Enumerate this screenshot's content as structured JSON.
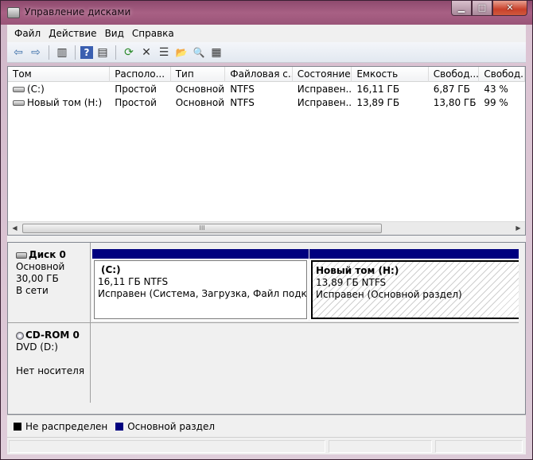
{
  "window": {
    "title": "Управление дисками",
    "minimize_glyph": "▁",
    "maximize_glyph": "□",
    "close_glyph": "✕"
  },
  "menu": {
    "items": [
      {
        "label": "Файл"
      },
      {
        "label": "Действие"
      },
      {
        "label": "Вид"
      },
      {
        "label": "Справка"
      }
    ]
  },
  "toolbar": {
    "buttons": [
      {
        "icon": "back-arrow-icon",
        "glyph": "⇦"
      },
      {
        "icon": "forward-arrow-icon",
        "glyph": "⇨"
      },
      {
        "icon": "show-hide-console-tree-icon",
        "glyph": "▥"
      },
      {
        "icon": "help-icon",
        "glyph": "?"
      },
      {
        "icon": "properties-pane-icon",
        "glyph": "▤"
      },
      {
        "icon": "refresh-icon",
        "glyph": "⟳"
      },
      {
        "icon": "delete-icon",
        "glyph": "✕"
      },
      {
        "icon": "properties-icon",
        "glyph": "☰"
      },
      {
        "icon": "open-folder-icon",
        "glyph": "📂"
      },
      {
        "icon": "search-icon",
        "glyph": "🔍"
      },
      {
        "icon": "disk-properties-icon",
        "glyph": "▦"
      }
    ]
  },
  "volume_list": {
    "columns": [
      "Том",
      "Располо...",
      "Тип",
      "Файловая с...",
      "Состояние",
      "Емкость",
      "Свобод...",
      "Свобод..."
    ],
    "rows": [
      {
        "volume": "(C:)",
        "layout": "Простой",
        "type": "Основной",
        "fs": "NTFS",
        "status": "Исправен...",
        "capacity": "16,11 ГБ",
        "free": "6,87 ГБ",
        "free_pct": "43 %"
      },
      {
        "volume": "Новый том (H:)",
        "layout": "Простой",
        "type": "Основной",
        "fs": "NTFS",
        "status": "Исправен...",
        "capacity": "13,89 ГБ",
        "free": "13,80 ГБ",
        "free_pct": "99 %"
      }
    ],
    "scroll_thumb_label": "III"
  },
  "disks": {
    "disk0": {
      "name": "Диск 0",
      "type": "Основной",
      "size": "30,00 ГБ",
      "state": "В сети",
      "partitions": [
        {
          "title": "(C:)",
          "size_fs": "16,11 ГБ NTFS",
          "status": "Исправен (Система, Загрузка, Файл подкачки,"
        },
        {
          "title": "Новый том  (H:)",
          "size_fs": "13,89 ГБ NTFS",
          "status": "Исправен (Основной раздел)"
        }
      ]
    },
    "cdrom0": {
      "name": "CD-ROM 0",
      "type": "DVD (D:)",
      "state": "Нет носителя"
    }
  },
  "legend": {
    "items": [
      {
        "label": "Не распределен",
        "color": "#000000"
      },
      {
        "label": "Основной раздел",
        "color": "#00007f"
      }
    ]
  }
}
